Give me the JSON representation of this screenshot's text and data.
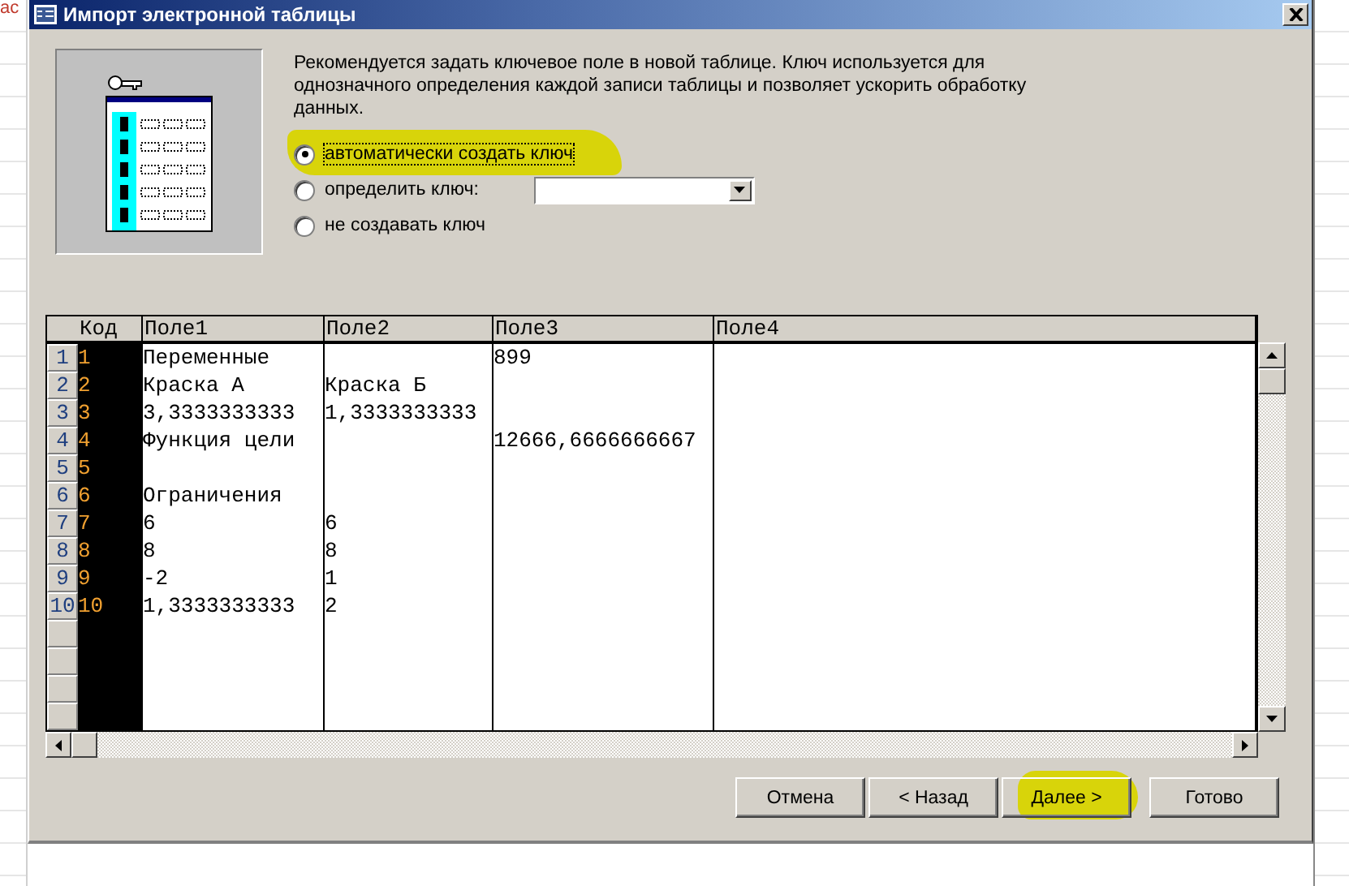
{
  "background": {
    "fragment": "ас"
  },
  "window": {
    "title": "Импорт электронной таблицы"
  },
  "description": "Рекомендуется задать ключевое поле в новой таблице.  Ключ используется для однозначного определения каждой записи таблицы и позволяет ускорить обработку данных.",
  "key_options": [
    {
      "label": "автоматически создать ключ",
      "selected": true,
      "highlighted": true,
      "kind": "plain"
    },
    {
      "label": "определить ключ:",
      "selected": false,
      "highlighted": false,
      "kind": "dropdown"
    },
    {
      "label": "не создавать ключ",
      "selected": false,
      "highlighted": false,
      "kind": "plain"
    }
  ],
  "table": {
    "columns": [
      "Код",
      "Поле1",
      "Поле2",
      "Поле3",
      "Поле4"
    ],
    "rows": [
      {
        "selector": "1",
        "cells": [
          "1",
          "Переменные",
          "",
          "899",
          ""
        ]
      },
      {
        "selector": "2",
        "cells": [
          "2",
          "Краска А",
          "Краска Б",
          "",
          ""
        ]
      },
      {
        "selector": "3",
        "cells": [
          "3",
          "3,3333333333",
          "1,3333333333",
          "",
          ""
        ]
      },
      {
        "selector": "4",
        "cells": [
          "4",
          "Функция цели",
          "",
          "12666,6666666667",
          ""
        ]
      },
      {
        "selector": "5",
        "cells": [
          "5",
          "",
          "",
          "",
          ""
        ]
      },
      {
        "selector": "6",
        "cells": [
          "6",
          "Ограничения",
          "",
          "",
          ""
        ]
      },
      {
        "selector": "7",
        "cells": [
          "7",
          "6",
          "6",
          "",
          ""
        ]
      },
      {
        "selector": "8",
        "cells": [
          "8",
          "8",
          "8",
          "",
          ""
        ]
      },
      {
        "selector": "9",
        "cells": [
          "9",
          "-2",
          "1",
          "",
          ""
        ]
      },
      {
        "selector": "10",
        "cells": [
          "10",
          "1,3333333333",
          "2",
          "",
          ""
        ]
      }
    ]
  },
  "buttons": [
    {
      "label": "Отмена",
      "highlighted": false
    },
    {
      "label": "< Назад",
      "highlighted": false
    },
    {
      "label": "Далее >",
      "highlighted": true
    },
    {
      "label": "Готово",
      "highlighted": false
    }
  ]
}
